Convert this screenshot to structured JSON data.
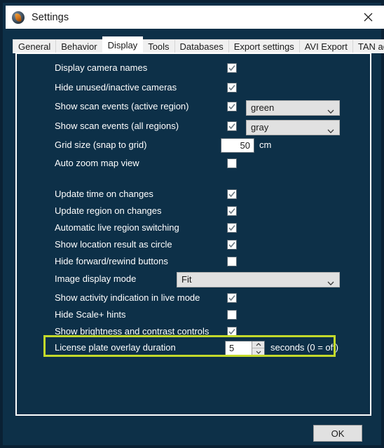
{
  "window": {
    "title": "Settings",
    "icon": "app-globe-icon",
    "close_label": "✕",
    "bg_color": "#0d3048",
    "titlebar_color": "#ffffff",
    "highlight_color": "#c3d92b"
  },
  "tabs": [
    {
      "label": "General",
      "active": false
    },
    {
      "label": "Behavior",
      "active": false
    },
    {
      "label": "Display",
      "active": true
    },
    {
      "label": "Tools",
      "active": false
    },
    {
      "label": "Databases",
      "active": false
    },
    {
      "label": "Export settings",
      "active": false
    },
    {
      "label": "AVI Export",
      "active": false
    },
    {
      "label": "TAN administration",
      "active": false
    }
  ],
  "display_settings": {
    "rows": [
      {
        "label": "Display camera names",
        "control": "checkbox",
        "checked": true
      },
      {
        "label": "Hide unused/inactive cameras",
        "control": "checkbox",
        "checked": true
      },
      {
        "label": "Show scan events (active region)",
        "control": "checkbox+combo",
        "checked": true,
        "combo_value": "green"
      },
      {
        "label": "Show scan events (all regions)",
        "control": "checkbox+combo",
        "checked": true,
        "combo_value": "gray"
      },
      {
        "label": "Grid size (snap to grid)",
        "control": "textbox",
        "value": "50",
        "unit": "cm"
      },
      {
        "label": "Auto zoom map view",
        "control": "checkbox",
        "checked": false
      },
      {
        "label": "Update time on changes",
        "control": "checkbox",
        "checked": true
      },
      {
        "label": "Update region on changes",
        "control": "checkbox",
        "checked": true
      },
      {
        "label": "Automatic live region switching",
        "control": "checkbox",
        "checked": true
      },
      {
        "label": "Show location result as circle",
        "control": "checkbox",
        "checked": true
      },
      {
        "label": "Hide forward/rewind buttons",
        "control": "checkbox",
        "checked": false
      },
      {
        "label": "Image display mode",
        "control": "combo",
        "combo_value": "Fit"
      },
      {
        "label": "Show activity indication in live mode",
        "control": "checkbox",
        "checked": true
      },
      {
        "label": "Hide Scale+ hints",
        "control": "checkbox",
        "checked": false
      },
      {
        "label": "Show brightness and contrast controls",
        "control": "checkbox",
        "checked": true
      },
      {
        "label": "License plate overlay duration",
        "control": "spinner",
        "value": "5",
        "unit": "seconds (0 = off)",
        "highlighted": true
      }
    ]
  },
  "footer": {
    "ok_label": "OK"
  }
}
